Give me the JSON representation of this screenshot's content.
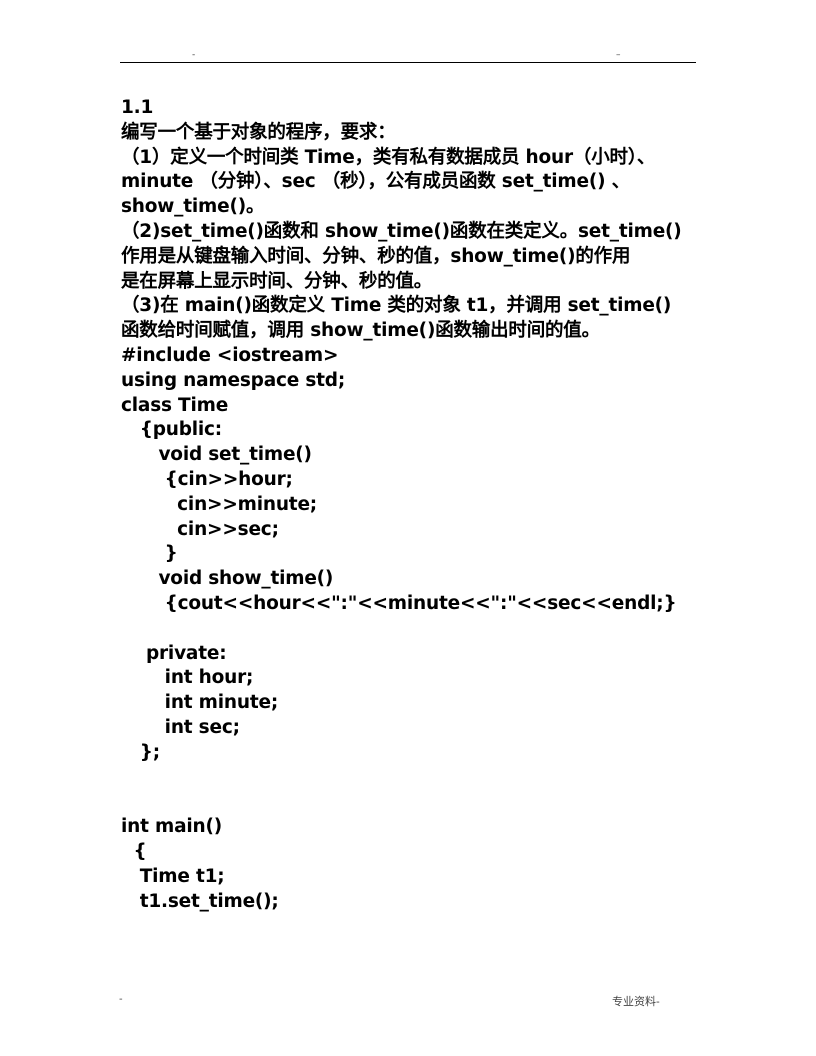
{
  "header": {
    "left_mark": "-",
    "right_mark": "–"
  },
  "document": {
    "section_number": "1.1",
    "intro": "编写一个基于对象的程序，要求：",
    "requirements": [
      "（1）定义一个时间类 Time，类有私有数据成员 hour（小时）、",
      "minute （分钟）、sec （秒），公有成员函数 set_time() 、",
      "show_time()。",
      "（2)set_time()函数和 show_time()函数在类定义。set_time()",
      "作用是从键盘输入时间、分钟、秒的值，show_time()的作用",
      "是在屏幕上显示时间、分钟、秒的值。",
      "（3)在 main()函数定义 Time 类的对象 t1，并调用 set_time()",
      "函数给时间赋值，调用 show_time()函数输出时间的值。"
    ],
    "code_lines": [
      "#include <iostream>",
      "using namespace std;",
      "class Time",
      "   {public:",
      "      void set_time()",
      "       {cin>>hour;",
      "         cin>>minute;",
      "         cin>>sec;",
      "       }",
      "      void show_time()",
      "       {cout<<hour<<\":\"<<minute<<\":\"<<sec<<endl;}",
      "",
      "    private:",
      "       int hour;",
      "       int minute;",
      "       int sec;",
      "   };",
      "",
      "",
      "int main()",
      "  {",
      "   Time t1;",
      "   t1.set_time();"
    ]
  },
  "footer": {
    "left_mark": "-",
    "right_text": "专业资料-"
  }
}
